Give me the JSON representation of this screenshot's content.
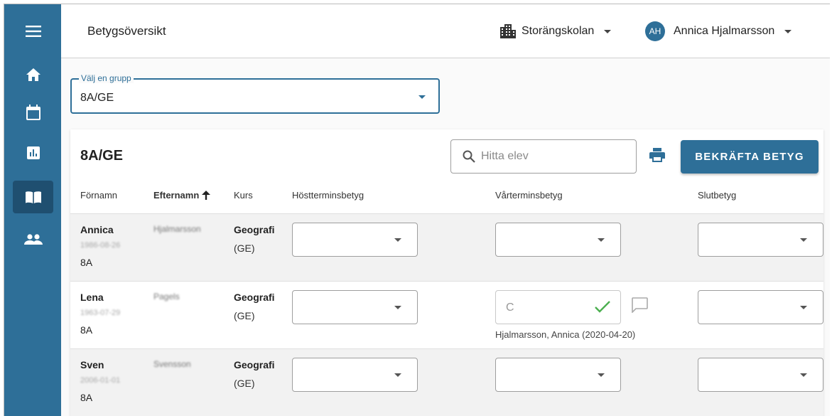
{
  "header": {
    "title": "Betygsöversikt",
    "school": "Storängskolan",
    "user_initials": "AH",
    "user_name": "Annica Hjalmarsson"
  },
  "group_select": {
    "label": "Välj en grupp",
    "value": "8A/GE"
  },
  "card": {
    "title": "8A/GE",
    "search_placeholder": "Hitta elev",
    "confirm_label": "BEKRÄFTA BETYG"
  },
  "columns": {
    "first": "Förnamn",
    "last": "Efternamn",
    "course": "Kurs",
    "autumn": "Höstterminsbetyg",
    "spring": "Vårterminsbetyg",
    "final": "Slutbetyg"
  },
  "students": [
    {
      "first": "Annica",
      "pnr": "1986-08-26",
      "class": "8A",
      "last": "Hjalmarsson",
      "course": "Geografi",
      "course_code": "(GE)"
    },
    {
      "first": "Lena",
      "pnr": "1963-07-29",
      "class": "8A",
      "last": "Pagels",
      "course": "Geografi",
      "course_code": "(GE)",
      "spring_grade": "C",
      "graded_by": "Hjalmarsson, Annica (2020-04-20)"
    },
    {
      "first": "Sven",
      "pnr": "2006-01-01",
      "class": "8A",
      "last": "Svensson",
      "course": "Geografi",
      "course_code": "(GE)"
    }
  ],
  "colors": {
    "sidebar": "#2e6f98",
    "sidebar_active": "#1f4f70",
    "accent": "#2e6f98",
    "check": "#4caf50"
  },
  "icons": [
    "menu-icon",
    "home-icon",
    "calendar-icon",
    "chart-icon",
    "book-icon",
    "people-icon",
    "building-icon",
    "search-icon",
    "print-icon",
    "check-icon",
    "comment-icon",
    "sort-arrow-up-icon"
  ]
}
